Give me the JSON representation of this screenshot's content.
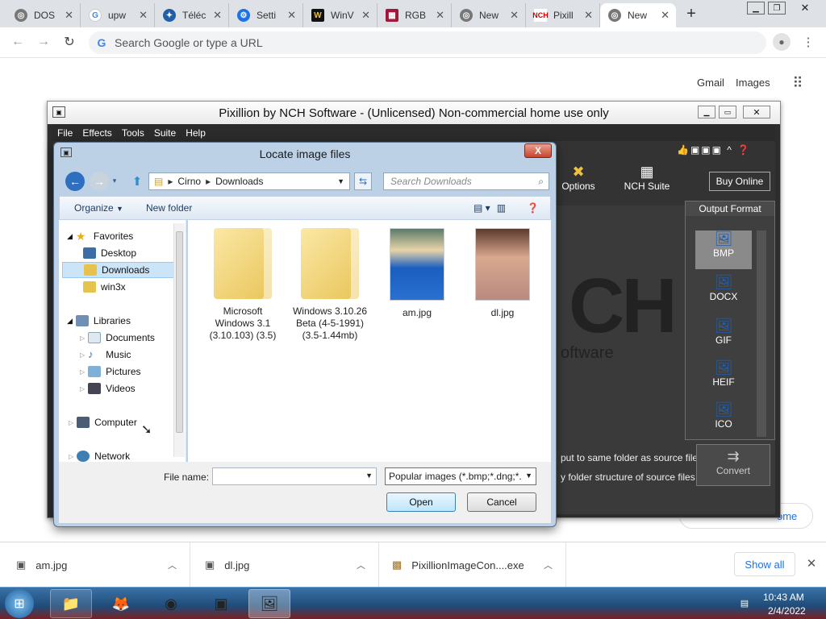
{
  "browser": {
    "tabs": [
      {
        "label": "DOS",
        "icon": "chrome-icon"
      },
      {
        "label": "upw",
        "icon": "google-icon"
      },
      {
        "label": "Téléc",
        "icon": "download-site-icon"
      },
      {
        "label": "Setti",
        "icon": "gear-icon"
      },
      {
        "label": "WinV",
        "icon": "winworld-icon"
      },
      {
        "label": "RGB",
        "icon": "rgb-icon"
      },
      {
        "label": "New",
        "icon": "chrome-icon"
      },
      {
        "label": "Pixill",
        "icon": "nch-icon"
      },
      {
        "label": "New",
        "icon": "chrome-icon"
      }
    ],
    "address_placeholder": "Search Google or type a URL",
    "gmail": "Gmail",
    "images": "Images"
  },
  "pixillion": {
    "title": "Pixillion by NCH Software - (Unlicensed) Non-commercial home use only",
    "menu": [
      "File",
      "Effects",
      "Tools",
      "Suite",
      "Help"
    ],
    "toolbar": {
      "options": "Options",
      "nch_suite": "NCH Suite",
      "buy_online": "Buy Online"
    },
    "output_format_label": "Output Format",
    "formats": [
      "BMP",
      "DOCX",
      "GIF",
      "HEIF",
      "ICO"
    ],
    "logo_text": "CH",
    "logo_sub": "oftware",
    "option1": "put to same folder as source files",
    "option2": "y folder structure of source files",
    "convert": "Convert",
    "home_fragment": "ome"
  },
  "dialog": {
    "title": "Locate image files",
    "close": "X",
    "breadcrumb": [
      "Cirno",
      "Downloads"
    ],
    "search_placeholder": "Search Downloads",
    "organize": "Organize",
    "new_folder": "New folder",
    "nav": {
      "favorites": "Favorites",
      "desktop": "Desktop",
      "downloads": "Downloads",
      "win3x": "win3x",
      "libraries": "Libraries",
      "documents": "Documents",
      "music": "Music",
      "pictures": "Pictures",
      "videos": "Videos",
      "computer": "Computer",
      "network": "Network"
    },
    "files": [
      {
        "name": "Microsoft Windows 3.1 (3.10.103) (3.5)",
        "type": "folder"
      },
      {
        "name": "Windows 3.10.26 Beta (4-5-1991) (3.5-1.44mb)",
        "type": "folder"
      },
      {
        "name": "am.jpg",
        "type": "image"
      },
      {
        "name": "dl.jpg",
        "type": "image"
      }
    ],
    "file_name_label": "File name:",
    "file_name_value": "",
    "filter": "Popular images (*.bmp;*.dng;*.",
    "open": "Open",
    "cancel": "Cancel"
  },
  "downloads": {
    "items": [
      {
        "name": "am.jpg"
      },
      {
        "name": "dl.jpg"
      },
      {
        "name": "PixillionImageCon....exe"
      }
    ],
    "show_all": "Show all"
  },
  "taskbar": {
    "time": "10:43 AM",
    "date": "2/4/2022"
  }
}
